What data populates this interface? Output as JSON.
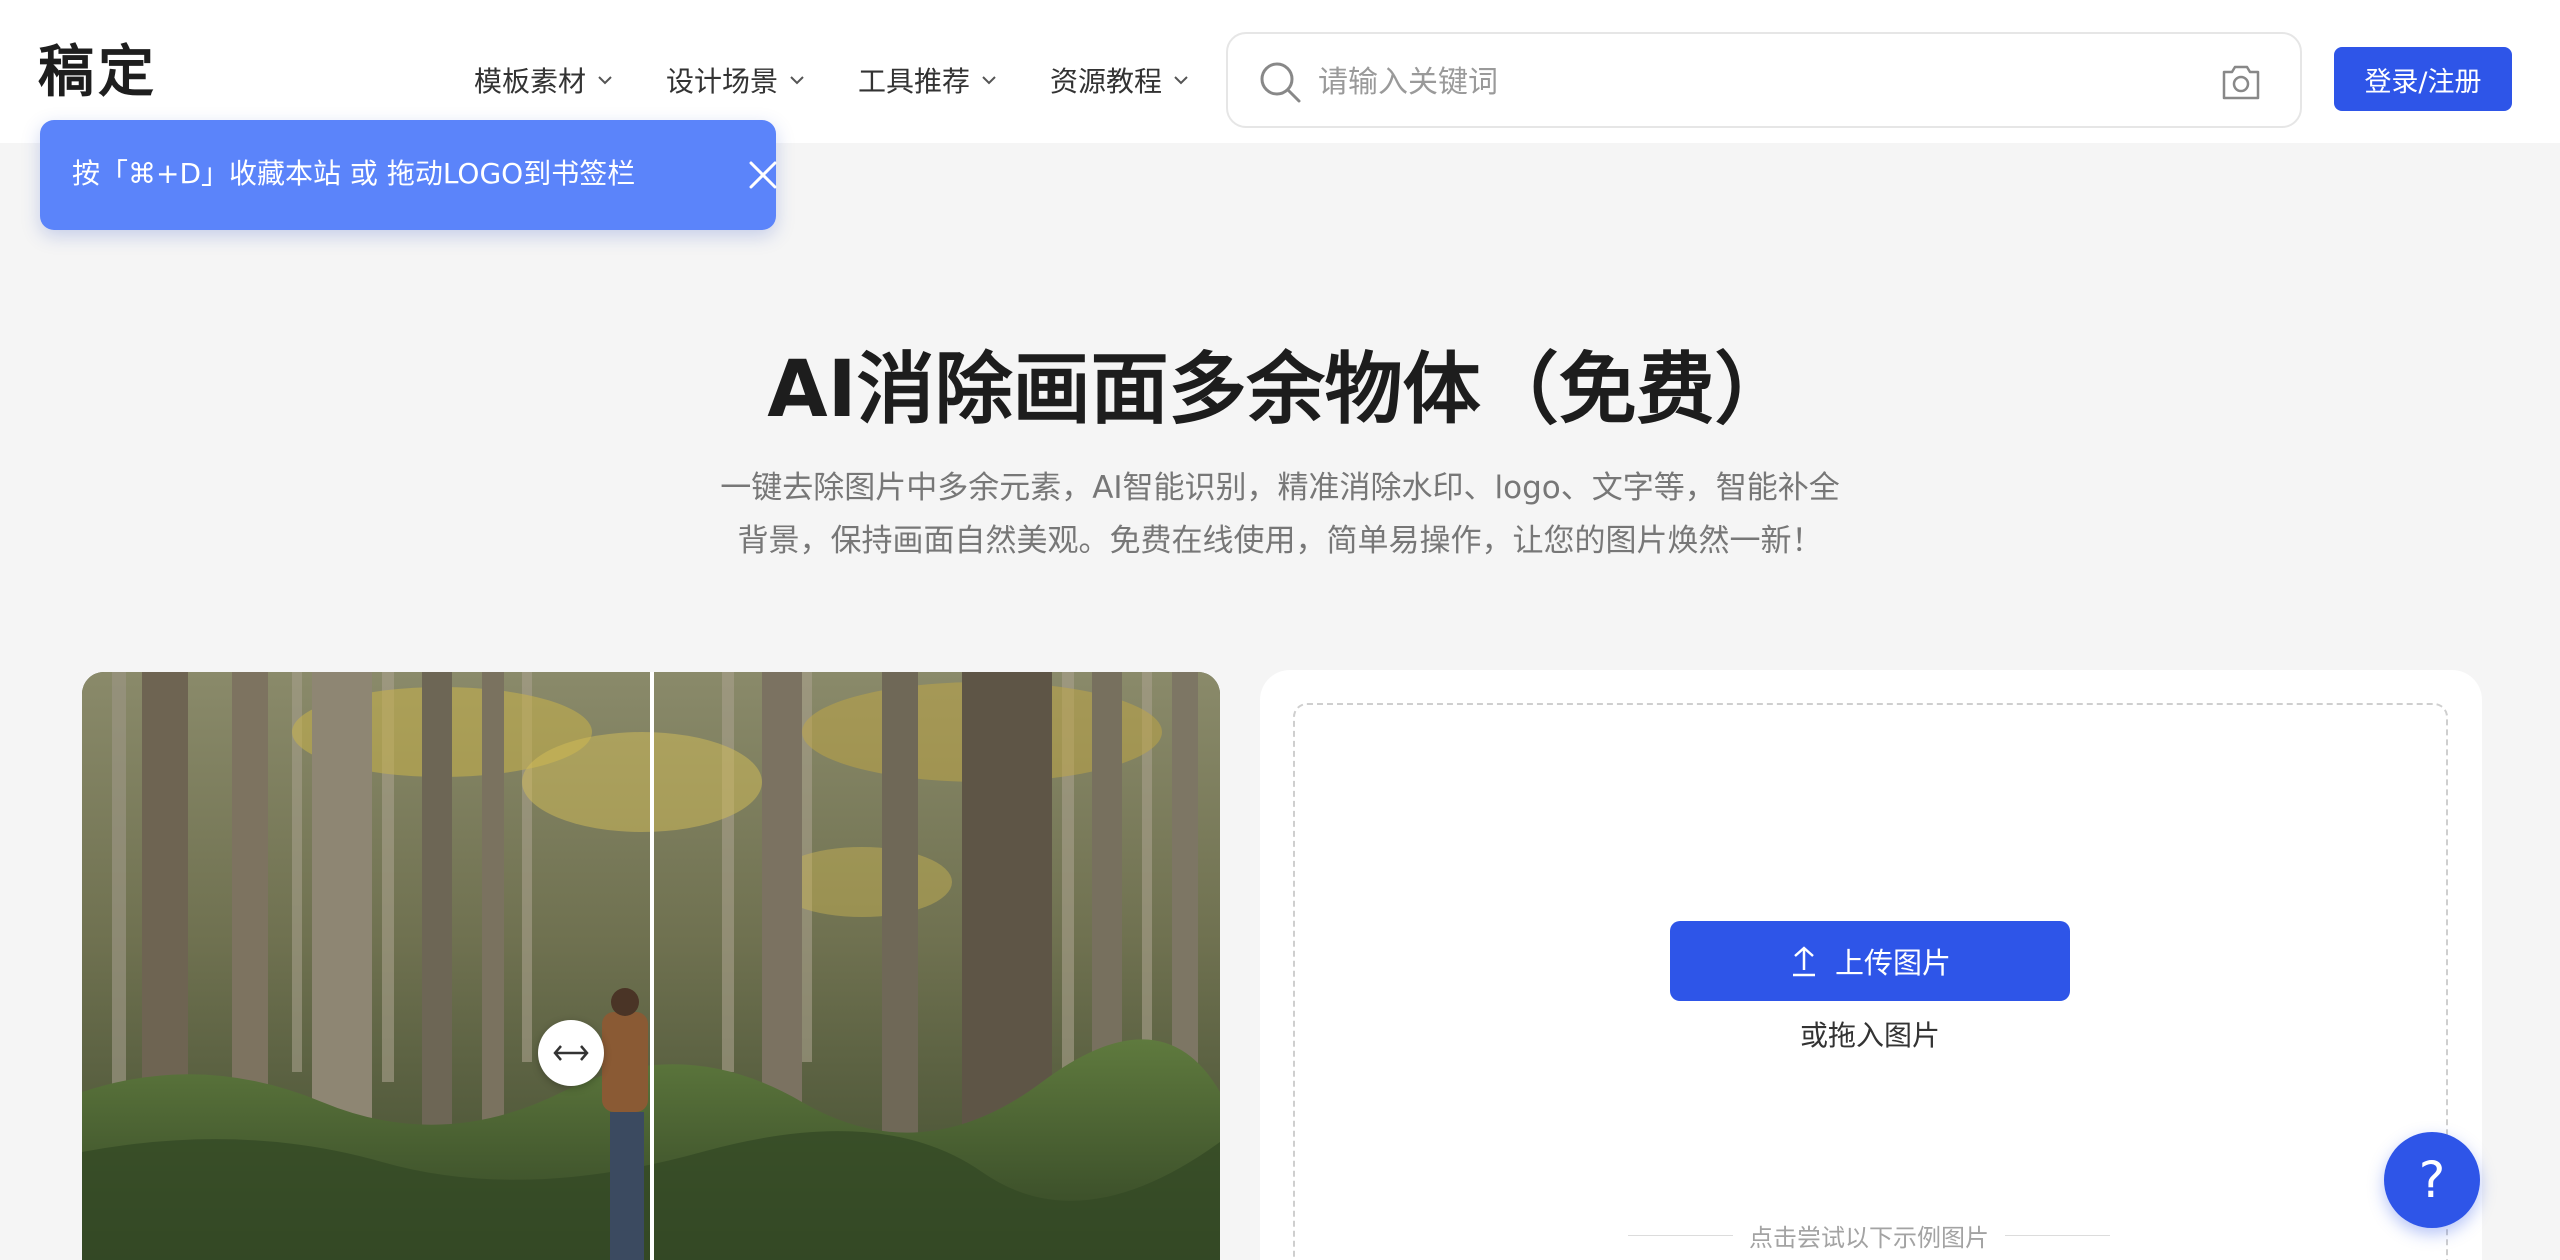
{
  "header": {
    "logo": "稿定",
    "nav": [
      {
        "label": "模板素材"
      },
      {
        "label": "设计场景"
      },
      {
        "label": "工具推荐"
      },
      {
        "label": "资源教程"
      }
    ],
    "search": {
      "placeholder": "请输入关键词"
    },
    "login_label": "登录/注册"
  },
  "tip": {
    "text": "按「⌘+D」收藏本站 或 拖动LOGO到书签栏"
  },
  "hero": {
    "title": "AI消除画面多余物体（免费）",
    "description": "一键去除图片中多余元素，AI智能识别，精准消除水印、logo、文字等，智能补全背景，保持画面自然美观。免费在线使用，简单易操作，让您的图片焕然一新！"
  },
  "upload": {
    "button_label": "上传图片",
    "drag_text": "或拖入图片",
    "sample_text": "点击尝试以下示例图片"
  },
  "help": {
    "label": "?"
  },
  "colors": {
    "accent": "#2e55e8",
    "tip_bg": "#5b84fa",
    "page_bg": "#f5f5f5"
  },
  "icons": [
    "chevron-down-icon",
    "search-icon",
    "camera-icon",
    "close-icon",
    "compare-arrows-icon",
    "upload-arrow-icon"
  ]
}
